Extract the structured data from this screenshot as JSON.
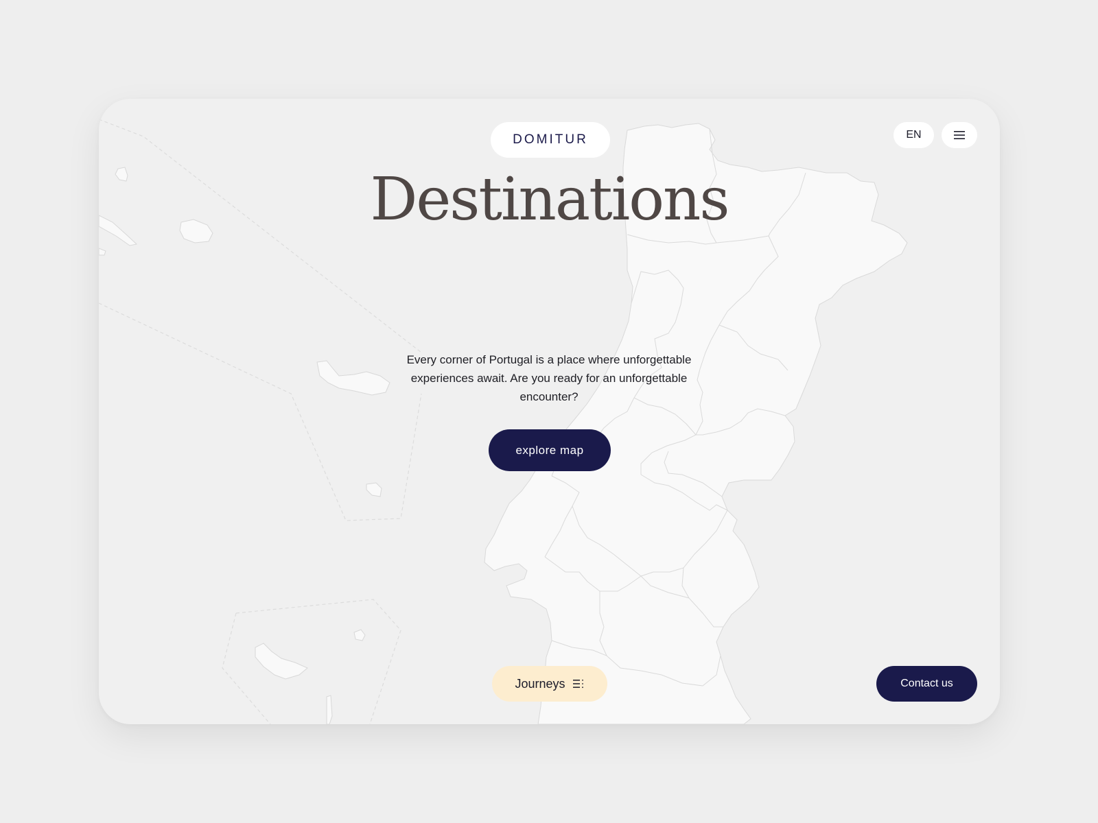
{
  "brand": {
    "logo_text": "DOMITUR"
  },
  "header": {
    "language_label": "EN",
    "menu_icon": "hamburger-icon"
  },
  "hero": {
    "title": "Destinations",
    "description": "Every corner of Portugal is a place where unforgettable experiences await. Are you ready for an unforgettable encounter?",
    "cta_label": "explore map"
  },
  "footer": {
    "journeys_label": "Journeys",
    "journeys_icon": "list-icon",
    "contact_label": "Contact us"
  },
  "colors": {
    "background": "#eeeeee",
    "card": "#f0f0f0",
    "land": "#f9f9f9",
    "navy": "#1a1a4b",
    "cream": "#fdedcf",
    "title": "#4f4745"
  }
}
